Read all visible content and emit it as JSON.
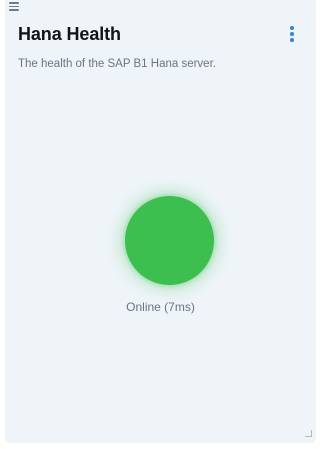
{
  "widget": {
    "title": "Hana Health",
    "subtitle": "The health of the SAP B1 Hana server.",
    "drag_handle_icon": "hamburger-icon",
    "menu_icon": "kebab-menu-icon"
  },
  "status": {
    "label": "Online (7ms)",
    "state": "online",
    "color": "#3dbf50"
  },
  "colors": {
    "card_background": "#eff4f9",
    "accent": "#3a86d6"
  }
}
